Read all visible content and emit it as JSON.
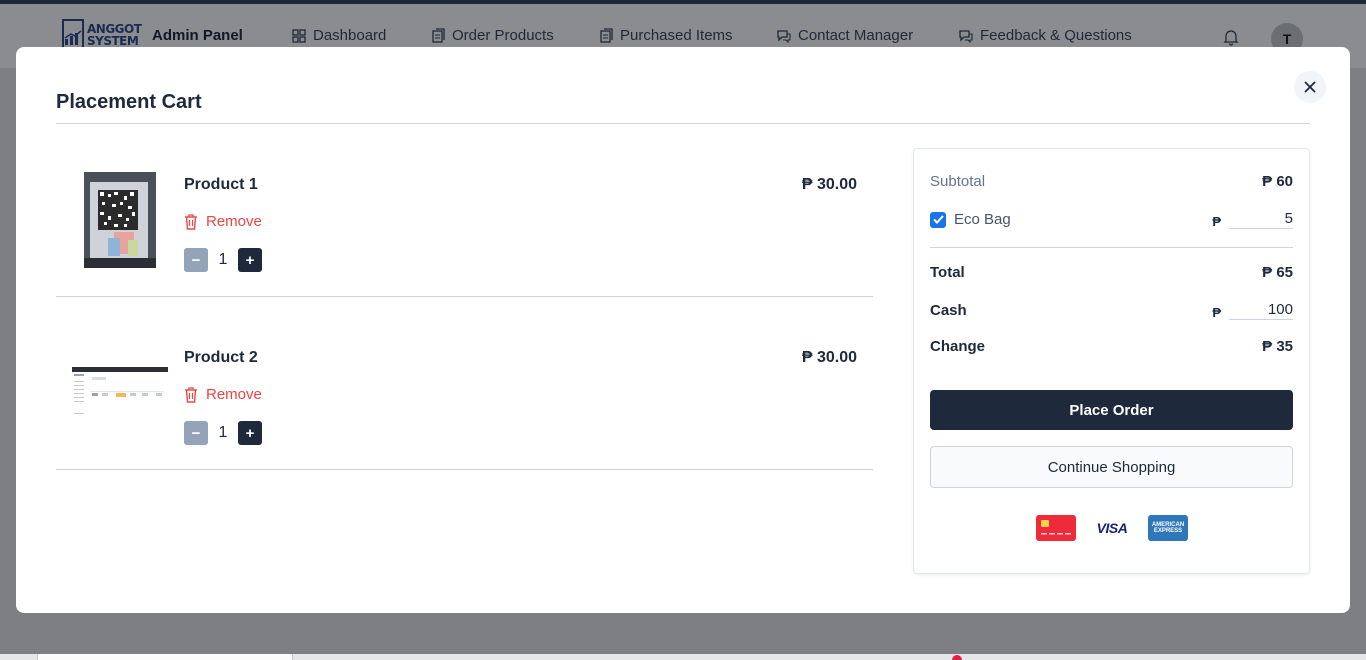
{
  "app": {
    "logo_text": "ANGGOT SYSTEM",
    "title": "Admin Panel",
    "nav": [
      {
        "label": "Dashboard",
        "icon": "grid-icon"
      },
      {
        "label": "Order Products",
        "icon": "clipboard-icon"
      },
      {
        "label": "Purchased Items",
        "icon": "clipboard-icon"
      },
      {
        "label": "Contact Manager",
        "icon": "chat-icon"
      },
      {
        "label": "Feedback & Questions",
        "icon": "chat-icon"
      }
    ],
    "avatar_initial": "T"
  },
  "modal": {
    "title": "Placement Cart",
    "items": [
      {
        "name": "Product 1",
        "price": "₱ 30.00",
        "remove_label": "Remove",
        "quantity": "1"
      },
      {
        "name": "Product 2",
        "price": "₱ 30.00",
        "remove_label": "Remove",
        "quantity": "1"
      }
    ],
    "summary": {
      "subtotal_label": "Subtotal",
      "subtotal_value": "₱ 60",
      "eco_bag_label": "Eco Bag",
      "eco_bag_checked": true,
      "eco_bag_currency": "₱",
      "eco_bag_value": "5",
      "total_label": "Total",
      "total_value": "₱ 65",
      "cash_label": "Cash",
      "cash_currency": "₱",
      "cash_value": "100",
      "change_label": "Change",
      "change_value": "₱ 35",
      "place_order_label": "Place Order",
      "continue_label": "Continue Shopping",
      "payment_cards": [
        "mastercard-icon",
        "visa-icon",
        "amex-icon"
      ],
      "visa_text": "VISA",
      "amex_text": "AMERICAN EXPRESS"
    }
  },
  "colors": {
    "primary": "#1e293b",
    "danger": "#ef4444",
    "checkbox": "#1a73e8"
  }
}
